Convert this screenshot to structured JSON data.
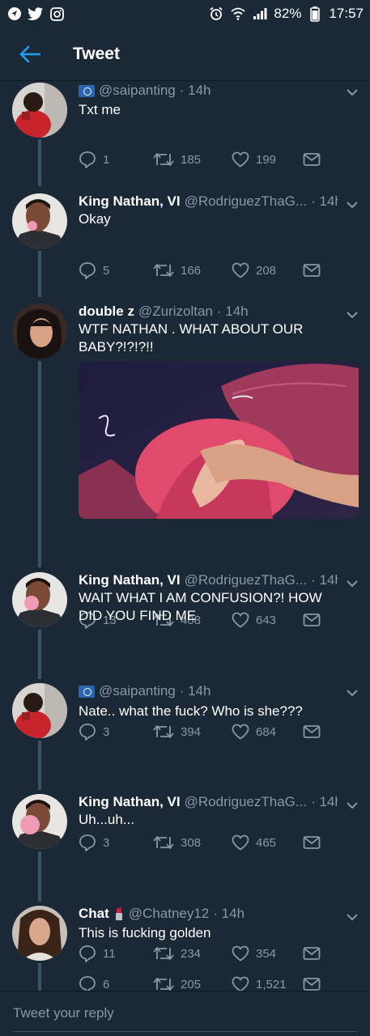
{
  "status_bar": {
    "battery": "82%",
    "time": "17:57"
  },
  "header": {
    "title": "Tweet"
  },
  "tweets": [
    {
      "name": "",
      "verified_flag": true,
      "handle": "@saipanting",
      "time": "· 14h",
      "text": "Txt me",
      "replies": "1",
      "retweets": "185",
      "likes": "199"
    },
    {
      "name": "King Nathan, VI",
      "verified_flag": false,
      "handle": "@RodriguezThaG...",
      "time": "· 14h",
      "text": "Okay",
      "replies": "5",
      "retweets": "166",
      "likes": "208"
    },
    {
      "name": "double z",
      "verified_flag": false,
      "handle": "@Zurizoltan",
      "time": "· 14h",
      "text": "WTF NATHAN . WHAT ABOUT OUR BABY?!?!?!!",
      "replies": "13",
      "retweets": "408",
      "likes": "643"
    },
    {
      "name": "King Nathan, VI",
      "verified_flag": false,
      "handle": "@RodriguezThaG...",
      "time": "· 14h",
      "text": "WAIT WHAT I AM CONFUSION?!  HOW DID YOU FIND ME",
      "replies": "3",
      "retweets": "394",
      "likes": "684"
    },
    {
      "name": "",
      "verified_flag": true,
      "handle": "@saipanting",
      "time": "· 14h",
      "text": "Nate.. what the fuck? Who is she???",
      "replies": "3",
      "retweets": "308",
      "likes": "465"
    },
    {
      "name": "King Nathan, VI",
      "verified_flag": false,
      "handle": "@RodriguezThaG...",
      "time": "· 14h",
      "text": "Uh...uh...",
      "replies": "11",
      "retweets": "234",
      "likes": "354"
    },
    {
      "name": "Chat",
      "verified_flag": false,
      "handle": "@Chatney12",
      "time": "· 14h",
      "text": "This is fucking golden",
      "replies": "6",
      "retweets": "205",
      "likes": "1,521"
    }
  ],
  "reply_box": {
    "placeholder": "Tweet your reply"
  },
  "colors": {
    "background": "#1b2836",
    "accent": "#1da1f2",
    "muted": "#8899a6",
    "thread_line": "#3d5466"
  }
}
